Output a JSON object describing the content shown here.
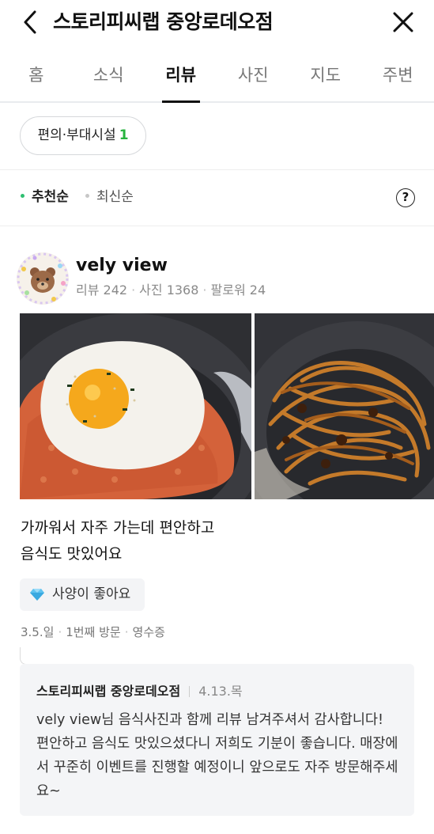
{
  "header": {
    "title": "스토리피씨랩 중앙로데오점",
    "back_icon": "chevron-left-icon",
    "close_icon": "close-icon"
  },
  "tabs": [
    {
      "label": "홈",
      "active": false
    },
    {
      "label": "소식",
      "active": false
    },
    {
      "label": "리뷰",
      "active": true
    },
    {
      "label": "사진",
      "active": false
    },
    {
      "label": "지도",
      "active": false
    },
    {
      "label": "주변",
      "active": false
    }
  ],
  "filter_chip": {
    "label": "편의·부대시설",
    "count": "1"
  },
  "sort": {
    "recommended": "추천순",
    "latest": "최신순",
    "help_icon": "question-circle-icon",
    "help_glyph": "?"
  },
  "review": {
    "user": {
      "name": "vely view",
      "reviews": "리뷰 242",
      "photos": "사진 1368",
      "followers": "팔로워 24"
    },
    "photos": [
      {
        "alt": "kimchi-fried-rice-with-fried-egg"
      },
      {
        "alt": "jjajang-ramen-noodles"
      }
    ],
    "text": "가까워서 자주 가는데 편안하고\n음식도 맛있어요",
    "keyword": {
      "icon": "diamond-icon",
      "label": "사양이 좋아요"
    },
    "visit": {
      "date": "3.5.일",
      "visit_count": "1번째 방문",
      "receipt": "영수증"
    },
    "reply": {
      "store": "스토리피씨랩 중앙로데오점",
      "date": "4.13.목",
      "body": "vely view님 음식사진과 함께 리뷰 남겨주셔서 감사합니다! 편안하고 음식도 맛있으셨다니 저희도 기분이 좋습니다. 매장에서 꾸준히 이벤트를 진행할 예정이니 앞으로도 자주 방문해주세요~"
    }
  },
  "colors": {
    "accent_green": "#27b33d",
    "sort_dot": "#2fbf71",
    "reply_bg": "#f4f5f7"
  }
}
